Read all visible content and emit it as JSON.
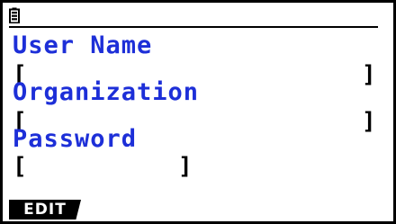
{
  "status_bar": {
    "battery_icon": "battery-icon"
  },
  "fields": [
    {
      "label": "User Name",
      "value": "",
      "open_bracket": "[",
      "close_bracket": "]"
    },
    {
      "label": "Organization",
      "value": "",
      "open_bracket": "[",
      "close_bracket": "]"
    },
    {
      "label": "Password",
      "value": "",
      "open_bracket": "[",
      "close_bracket": "]"
    }
  ],
  "softkeys": {
    "f1_label": "EDIT"
  },
  "colors": {
    "label_color": "#1d2fd8",
    "text_color": "#000000",
    "background": "#ffffff"
  }
}
